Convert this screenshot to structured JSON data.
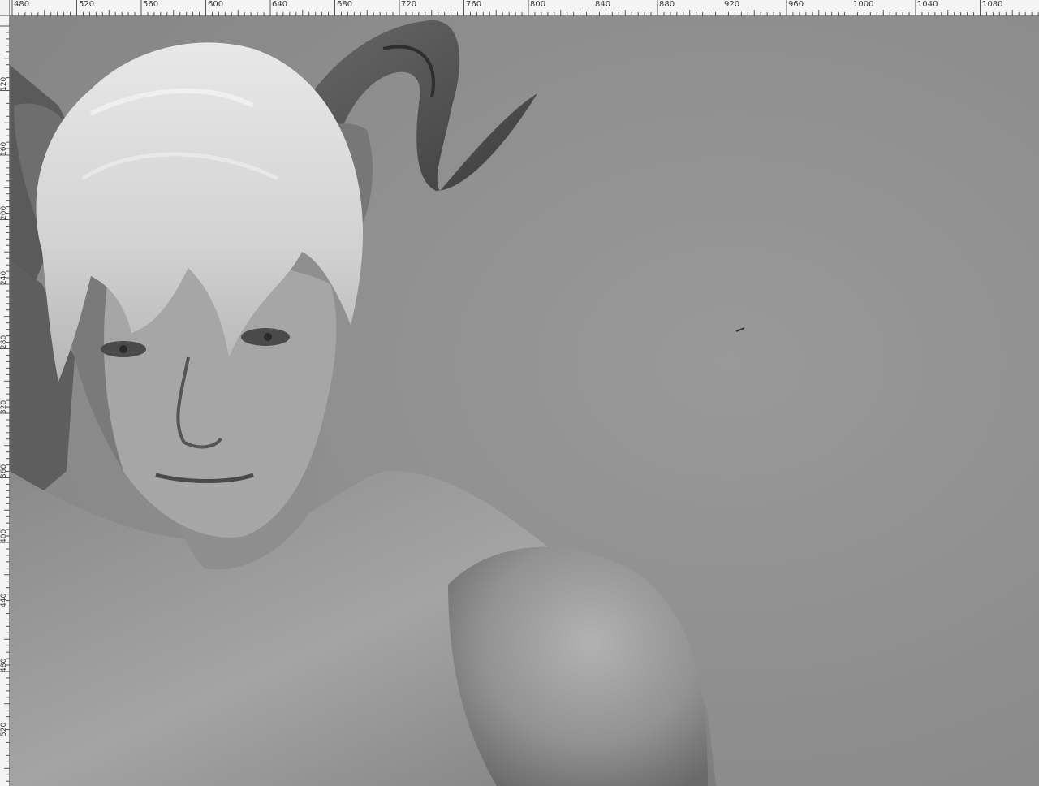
{
  "rulers": {
    "horizontal_labels": [
      "480",
      "520",
      "560",
      "600",
      "640",
      "680",
      "720",
      "760",
      "800",
      "840",
      "880",
      "920",
      "960",
      "1000",
      "1040",
      "1080"
    ],
    "vertical_labels": [
      "120",
      "160",
      "200",
      "240",
      "280",
      "320",
      "360",
      "400",
      "440",
      "480",
      "520"
    ]
  },
  "canvas": {
    "background_color": "#8d8d8d",
    "artwork": "grayscale-painting-horned-character"
  },
  "colors": {
    "ruler_bg": "#f4f4f4",
    "ruler_text": "#3a3a3a"
  }
}
